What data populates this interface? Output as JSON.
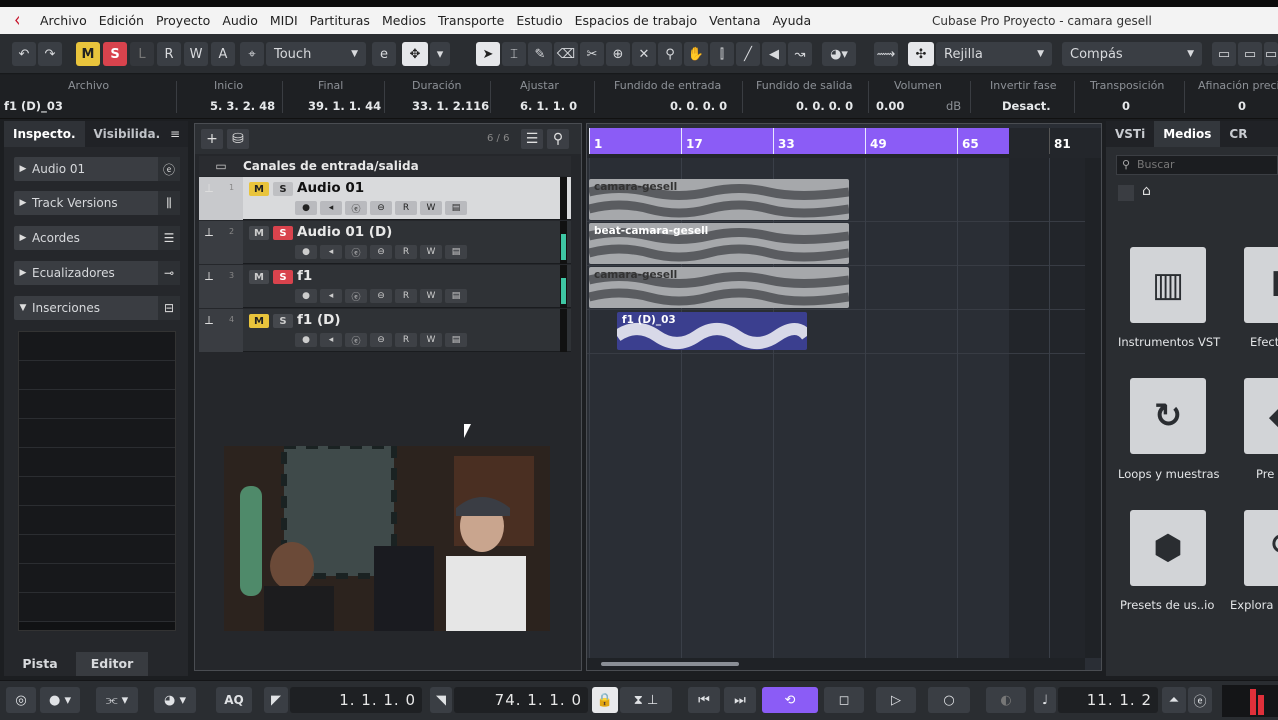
{
  "app": {
    "window_title": "Cubase Pro Proyecto - camara gesell",
    "menu": [
      "Archivo",
      "Edición",
      "Proyecto",
      "Audio",
      "MIDI",
      "Partituras",
      "Medios",
      "Transporte",
      "Estudio",
      "Espacios de trabajo",
      "Ventana",
      "Ayuda"
    ]
  },
  "toolbar": {
    "m_label": "M",
    "s_label": "S",
    "l_label": "L",
    "r_label": "R",
    "w_label": "W",
    "a_label": "A",
    "automation_mode": "Touch",
    "snap_type": "Rejilla",
    "grid_type": "Compás"
  },
  "infoline": {
    "columns": [
      {
        "label": "Archivo",
        "value": "f1 (D)_03"
      },
      {
        "label": "Inicio",
        "value": "5. 3. 2. 48"
      },
      {
        "label": "Final",
        "value": "39. 1. 1. 44"
      },
      {
        "label": "Duración",
        "value": "33. 1. 2.116"
      },
      {
        "label": "Ajustar",
        "value": "6. 1. 1.   0"
      },
      {
        "label": "Fundido de entrada",
        "value": "0. 0. 0.   0"
      },
      {
        "label": "Fundido de salida",
        "value": "0. 0. 0.   0"
      },
      {
        "label": "Volumen",
        "value": "0.00",
        "unit": "dB"
      },
      {
        "label": "Invertir fase",
        "value": "Desact."
      },
      {
        "label": "Transposición",
        "value": "0"
      },
      {
        "label": "Afinación precis",
        "value": "0"
      }
    ]
  },
  "inspector": {
    "tabs": [
      "Inspecto.",
      "Visibilida."
    ],
    "track_name": "Audio 01",
    "sections": [
      "Track Versions",
      "Acordes",
      "Ecualizadores",
      "Inserciones"
    ],
    "bottom_tabs": [
      "Pista",
      "Editor"
    ]
  },
  "tracklist": {
    "count": "6 / 6",
    "folder": "Canales de entrada/salida",
    "tracks": [
      {
        "num": "1",
        "name": "Audio 01",
        "m": "M",
        "s": "S"
      },
      {
        "num": "2",
        "name": "Audio 01 (D)",
        "m": "M",
        "s": "S"
      },
      {
        "num": "3",
        "name": "f1",
        "m": "M",
        "s": "S"
      },
      {
        "num": "4",
        "name": "f1 (D)",
        "m": "M",
        "s": "S"
      }
    ]
  },
  "arrange": {
    "ruler": [
      "1",
      "17",
      "33",
      "49",
      "65",
      "81"
    ],
    "events": [
      {
        "name": "camara-gesell"
      },
      {
        "name": "beat-camara-gesell"
      },
      {
        "name": "camara-gesell"
      },
      {
        "name": "f1 (D)_03"
      }
    ]
  },
  "rack": {
    "tabs": [
      "VSTi",
      "Medios",
      "CR"
    ],
    "search_placeholder": "Buscar",
    "tiles": [
      {
        "label": "Instrumentos VST",
        "icon": "piano-icon"
      },
      {
        "label": "Efect",
        "icon": "effects-icon"
      },
      {
        "label": "Loops y muestras",
        "icon": "loop-icon"
      },
      {
        "label": "Pre",
        "icon": "presets-icon"
      },
      {
        "label": "Presets de us..io",
        "icon": "user-presets-icon"
      },
      {
        "label": "Explora",
        "icon": "browse-icon"
      }
    ]
  },
  "transport": {
    "left_locator": "1.   1.   1.     0",
    "right_locator": "74.   1.   1.     0",
    "position": "11.   1.   2",
    "aq": "AQ"
  },
  "colors": {
    "accent": "#8b5cf6",
    "event_bg": "#a6a8ab",
    "event_sel": "#3b3f8f",
    "mute": "#e9c43c",
    "solo": "#d9434d"
  }
}
